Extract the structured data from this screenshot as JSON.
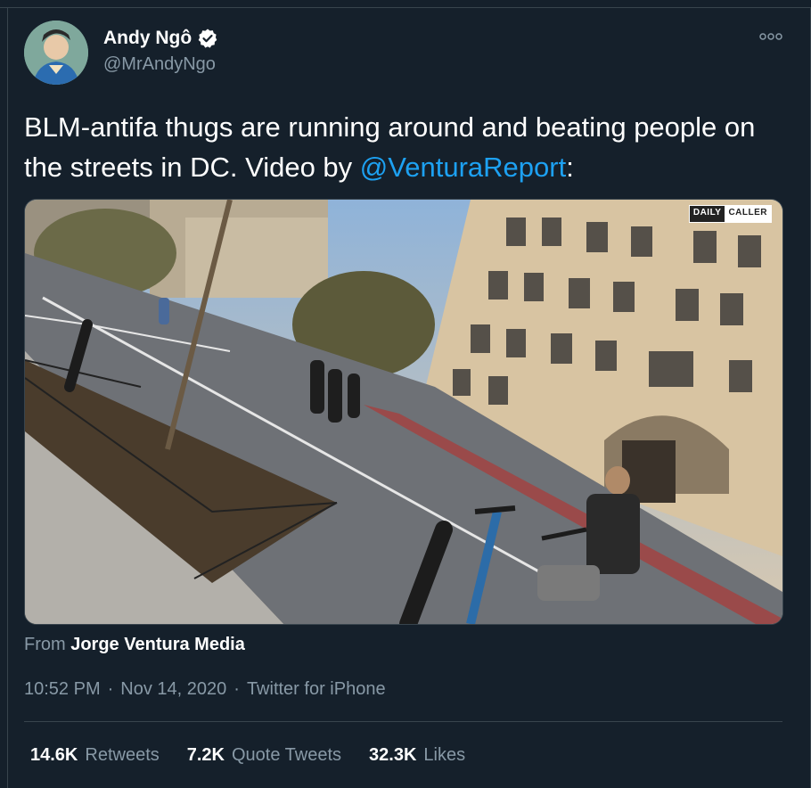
{
  "tweet": {
    "author_name": "Andy Ngô",
    "author_handle": "@MrAndyNgo",
    "text_before": "BLM-antifa thugs are running around and beating people on the streets in DC. Video by ",
    "mention": "@VenturaReport",
    "text_after": ":",
    "media_watermark": {
      "left": "DAILY",
      "right": "CALLER"
    },
    "source_prefix": "From ",
    "source_name": "Jorge Ventura Media",
    "time": "10:52 PM",
    "date": "Nov 14, 2020",
    "client": "Twitter for iPhone",
    "separator": "·"
  },
  "stats": [
    {
      "count": "14.6K",
      "label": "Retweets"
    },
    {
      "count": "7.2K",
      "label": "Quote Tweets"
    },
    {
      "count": "32.3K",
      "label": "Likes"
    }
  ],
  "colors": {
    "background": "#15202b",
    "link": "#1da1f2",
    "muted": "#8899a6",
    "divider": "#38444d"
  },
  "icons": {
    "verified": "verified-badge-icon",
    "more": "more-options-icon"
  }
}
